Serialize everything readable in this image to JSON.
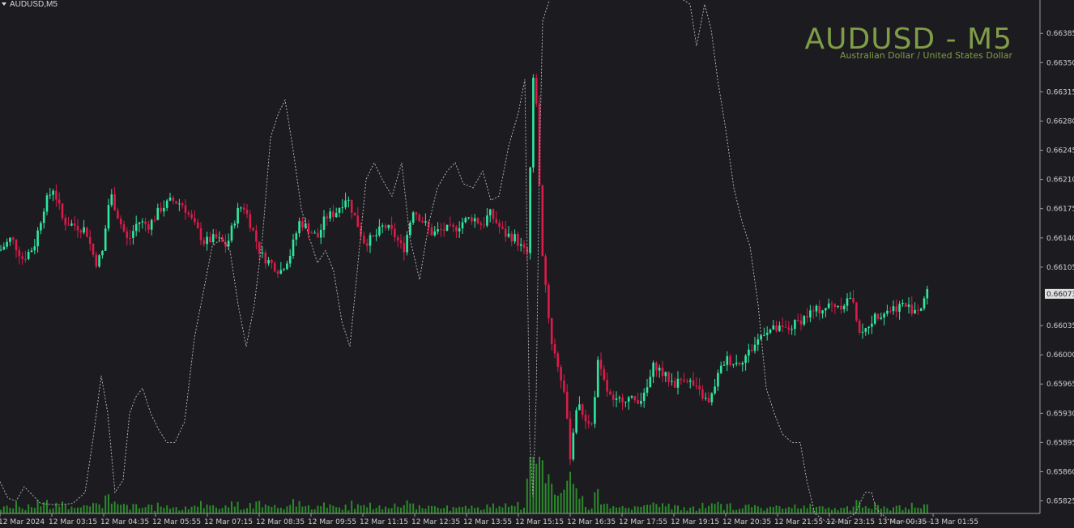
{
  "header": {
    "symbol_tag": "AUDUSD,M5",
    "title": "AUDUSD - M5",
    "subtitle": "Australian Dollar / United States Dollar"
  },
  "colors": {
    "background": "#1c1b20",
    "bull": "#2fe8a0",
    "bear": "#dc1b4a",
    "volume": "#2b8a2b",
    "indicator": "#bdbdbd",
    "title": "#7f9c47",
    "axis_text": "#d0d0d0",
    "current_price_box": "#e0e0e0"
  },
  "chart_data": {
    "type": "candlestick",
    "y_axis": {
      "ylim": [
        0.6581,
        0.66425
      ],
      "tick_labels": [
        "0.66385",
        "0.66350",
        "0.66315",
        "0.66280",
        "0.66245",
        "0.66210",
        "0.66175",
        "0.66140",
        "0.66105",
        "0.66035",
        "0.66000",
        "0.65965",
        "0.65930",
        "0.65895",
        "0.65860",
        "0.65825"
      ],
      "current_price": "0.66073"
    },
    "x_axis": {
      "tick_labels": [
        "12 Mar 2024",
        "12 Mar 03:15",
        "12 Mar 04:35",
        "12 Mar 05:55",
        "12 Mar 07:15",
        "12 Mar 08:35",
        "12 Mar 09:55",
        "12 Mar 11:15",
        "12 Mar 12:35",
        "12 Mar 13:55",
        "12 Mar 15:15",
        "12 Mar 16:35",
        "12 Mar 17:55",
        "12 Mar 19:15",
        "12 Mar 20:35",
        "12 Mar 21:55",
        "12 Mar 23:15",
        "13 Mar 00:35",
        "13 Mar 01:55"
      ]
    },
    "price_path": [
      [
        0,
        0.66125
      ],
      [
        14,
        0.6614
      ],
      [
        28,
        0.66115
      ],
      [
        42,
        0.6613
      ],
      [
        55,
        0.6618
      ],
      [
        66,
        0.662
      ],
      [
        78,
        0.6616
      ],
      [
        92,
        0.66155
      ],
      [
        106,
        0.6615
      ],
      [
        118,
        0.6611
      ],
      [
        126,
        0.6612
      ],
      [
        136,
        0.66195
      ],
      [
        146,
        0.66165
      ],
      [
        158,
        0.66135
      ],
      [
        170,
        0.6616
      ],
      [
        184,
        0.66155
      ],
      [
        198,
        0.66175
      ],
      [
        212,
        0.66185
      ],
      [
        226,
        0.6618
      ],
      [
        240,
        0.66155
      ],
      [
        252,
        0.66135
      ],
      [
        266,
        0.6614
      ],
      [
        280,
        0.6613
      ],
      [
        292,
        0.6617
      ],
      [
        300,
        0.6618
      ],
      [
        310,
        0.66155
      ],
      [
        322,
        0.6612
      ],
      [
        334,
        0.6611
      ],
      [
        346,
        0.661
      ],
      [
        358,
        0.6612
      ],
      [
        370,
        0.6616
      ],
      [
        382,
        0.6615
      ],
      [
        392,
        0.6614
      ],
      [
        402,
        0.66165
      ],
      [
        414,
        0.6617
      ],
      [
        428,
        0.6619
      ],
      [
        438,
        0.66165
      ],
      [
        450,
        0.66135
      ],
      [
        462,
        0.6614
      ],
      [
        474,
        0.66155
      ],
      [
        486,
        0.66145
      ],
      [
        498,
        0.66125
      ],
      [
        510,
        0.66175
      ],
      [
        522,
        0.6616
      ],
      [
        534,
        0.66145
      ],
      [
        546,
        0.6615
      ],
      [
        560,
        0.6615
      ],
      [
        572,
        0.6616
      ],
      [
        584,
        0.66165
      ],
      [
        596,
        0.66155
      ],
      [
        604,
        0.6617
      ],
      [
        612,
        0.6616
      ],
      [
        622,
        0.66145
      ],
      [
        636,
        0.6614
      ],
      [
        646,
        0.66125
      ],
      [
        652,
        0.6612
      ],
      [
        656,
        0.6628
      ],
      [
        660,
        0.6636
      ],
      [
        664,
        0.6626
      ],
      [
        668,
        0.6614
      ],
      [
        674,
        0.6608
      ],
      [
        680,
        0.6602
      ],
      [
        688,
        0.6599
      ],
      [
        696,
        0.6596
      ],
      [
        704,
        0.6588
      ],
      [
        712,
        0.6594
      ],
      [
        720,
        0.6593
      ],
      [
        730,
        0.6591
      ],
      [
        738,
        0.6599
      ],
      [
        748,
        0.6596
      ],
      [
        758,
        0.6594
      ],
      [
        770,
        0.6595
      ],
      [
        782,
        0.65945
      ],
      [
        796,
        0.6595
      ],
      [
        808,
        0.6599
      ],
      [
        820,
        0.65975
      ],
      [
        834,
        0.65965
      ],
      [
        846,
        0.65975
      ],
      [
        858,
        0.6596
      ],
      [
        868,
        0.6595
      ],
      [
        876,
        0.6594
      ],
      [
        884,
        0.6597
      ],
      [
        896,
        0.65995
      ],
      [
        910,
        0.6599
      ],
      [
        922,
        0.66
      ],
      [
        934,
        0.66015
      ],
      [
        944,
        0.6603
      ],
      [
        958,
        0.6603
      ],
      [
        972,
        0.6603
      ],
      [
        986,
        0.6604
      ],
      [
        1000,
        0.6605
      ],
      [
        1014,
        0.66055
      ],
      [
        1028,
        0.6606
      ],
      [
        1040,
        0.6606
      ],
      [
        1050,
        0.6607
      ],
      [
        1056,
        0.6605
      ],
      [
        1064,
        0.6602
      ],
      [
        1074,
        0.6604
      ],
      [
        1086,
        0.6605
      ],
      [
        1100,
        0.66055
      ],
      [
        1114,
        0.6606
      ],
      [
        1126,
        0.66055
      ],
      [
        1136,
        0.66055
      ],
      [
        1142,
        0.6607
      ],
      [
        1148,
        0.66078
      ]
    ],
    "indicator_path": [
      [
        0,
        0.65848
      ],
      [
        10,
        0.65828
      ],
      [
        20,
        0.65825
      ],
      [
        30,
        0.65842
      ],
      [
        40,
        0.65832
      ],
      [
        50,
        0.65822
      ],
      [
        70,
        0.6582
      ],
      [
        90,
        0.65822
      ],
      [
        105,
        0.65835
      ],
      [
        115,
        0.659
      ],
      [
        125,
        0.65975
      ],
      [
        133,
        0.6593
      ],
      [
        142,
        0.65835
      ],
      [
        152,
        0.6585
      ],
      [
        160,
        0.6593
      ],
      [
        168,
        0.6595
      ],
      [
        176,
        0.6596
      ],
      [
        186,
        0.6593
      ],
      [
        196,
        0.6591
      ],
      [
        206,
        0.65895
      ],
      [
        216,
        0.65895
      ],
      [
        228,
        0.6592
      ],
      [
        240,
        0.6602
      ],
      [
        252,
        0.6608
      ],
      [
        262,
        0.6613
      ],
      [
        274,
        0.6614
      ],
      [
        284,
        0.66125
      ],
      [
        294,
        0.6606
      ],
      [
        304,
        0.6601
      ],
      [
        314,
        0.6606
      ],
      [
        324,
        0.6614
      ],
      [
        334,
        0.6626
      ],
      [
        344,
        0.6629
      ],
      [
        352,
        0.66305
      ],
      [
        362,
        0.66245
      ],
      [
        372,
        0.66175
      ],
      [
        382,
        0.6614
      ],
      [
        392,
        0.6611
      ],
      [
        402,
        0.66125
      ],
      [
        412,
        0.661
      ],
      [
        422,
        0.6604
      ],
      [
        432,
        0.6601
      ],
      [
        442,
        0.6611
      ],
      [
        452,
        0.6621
      ],
      [
        462,
        0.6623
      ],
      [
        472,
        0.6621
      ],
      [
        484,
        0.6619
      ],
      [
        496,
        0.6623
      ],
      [
        506,
        0.6614
      ],
      [
        518,
        0.6609
      ],
      [
        530,
        0.6616
      ],
      [
        540,
        0.662
      ],
      [
        552,
        0.6622
      ],
      [
        562,
        0.6623
      ],
      [
        572,
        0.66205
      ],
      [
        584,
        0.662
      ],
      [
        596,
        0.6622
      ],
      [
        606,
        0.66185
      ],
      [
        616,
        0.6619
      ],
      [
        628,
        0.6625
      ],
      [
        640,
        0.6629
      ],
      [
        648,
        0.6633
      ],
      [
        654,
        0.659
      ],
      [
        658,
        0.6583
      ],
      [
        662,
        0.6595
      ],
      [
        666,
        0.6623
      ],
      [
        670,
        0.664
      ],
      [
        680,
        0.6643
      ],
      [
        700,
        0.6644
      ],
      [
        760,
        0.6644
      ],
      [
        820,
        0.6644
      ],
      [
        852,
        0.6642
      ],
      [
        860,
        0.6637
      ],
      [
        870,
        0.6642
      ],
      [
        878,
        0.6639
      ],
      [
        886,
        0.6633
      ],
      [
        896,
        0.6627
      ],
      [
        906,
        0.662
      ],
      [
        916,
        0.6616
      ],
      [
        926,
        0.6613
      ],
      [
        936,
        0.6606
      ],
      [
        946,
        0.6596
      ],
      [
        956,
        0.6593
      ],
      [
        966,
        0.65905
      ],
      [
        978,
        0.65895
      ],
      [
        988,
        0.65895
      ],
      [
        996,
        0.6585
      ],
      [
        1006,
        0.6581
      ],
      [
        1020,
        0.658
      ],
      [
        1040,
        0.658
      ],
      [
        1056,
        0.6581
      ],
      [
        1068,
        0.65835
      ],
      [
        1076,
        0.65835
      ],
      [
        1082,
        0.65815
      ],
      [
        1100,
        0.658
      ],
      [
        1150,
        0.658
      ]
    ]
  }
}
